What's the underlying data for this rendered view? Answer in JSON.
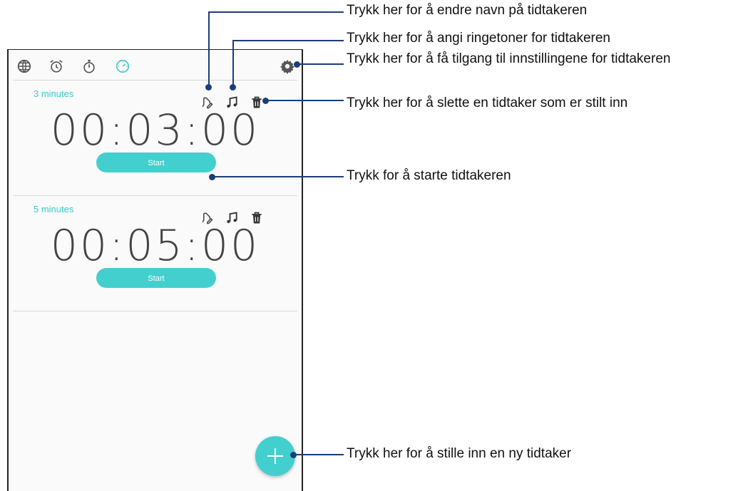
{
  "tabs": [
    {
      "name": "world-clock",
      "icon": "globe-icon"
    },
    {
      "name": "alarm",
      "icon": "alarm-clock-icon"
    },
    {
      "name": "stopwatch",
      "icon": "stopwatch-icon"
    },
    {
      "name": "timer",
      "icon": "timer-icon",
      "active": true
    }
  ],
  "settings_icon": "gear-icon",
  "timers": [
    {
      "label": "3 minutes",
      "time": "00:03:00",
      "start_label": "Start"
    },
    {
      "label": "5 minutes",
      "time": "00:05:00",
      "start_label": "Start"
    }
  ],
  "add_button_icon": "plus-icon",
  "callouts": {
    "rename": "Trykk her for å endre navn på tidtakeren",
    "ringtone": "Trykk her for å angi ringetoner for tidtakeren",
    "settings": "Trykk her for å få tilgang til innstillingene for tidtakeren",
    "delete": "Trykk her for å slette en tidtaker som er stilt inn",
    "start": "Trykk for å starte tidtakeren",
    "add": "Trykk her for å stille inn en ny tidtaker"
  },
  "colors": {
    "accent": "#44cfcf",
    "callout": "#1a3d7c",
    "time_text": "#444444"
  }
}
